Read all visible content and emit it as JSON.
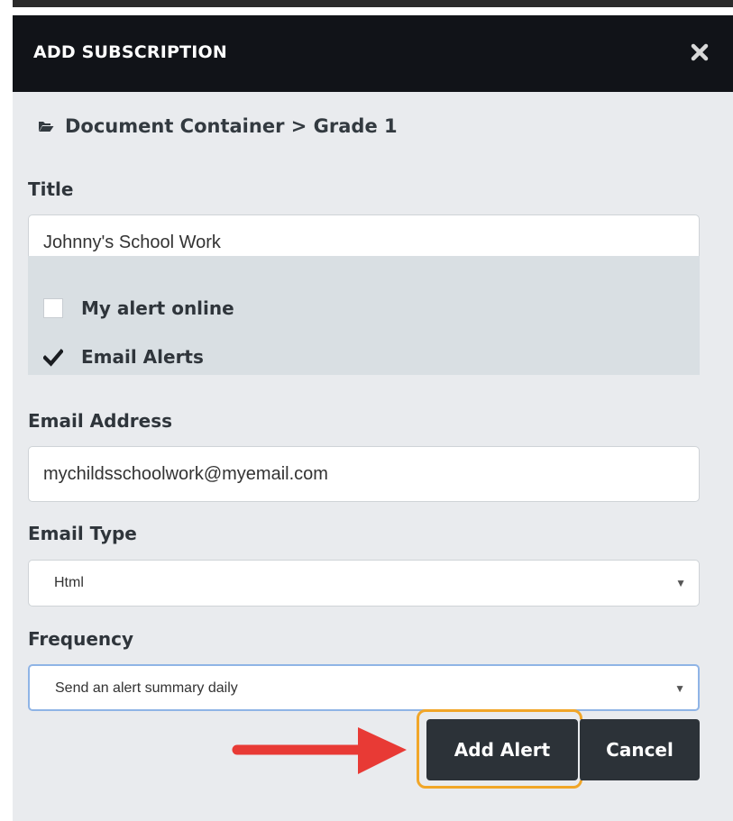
{
  "dialog": {
    "title": "ADD SUBSCRIPTION",
    "close_icon": "close-icon"
  },
  "breadcrumb": {
    "icon": "folder-open-icon",
    "text": "Document Container > Grade 1"
  },
  "form": {
    "title_label": "Title",
    "title_value": "Johnny's School Work",
    "checkboxes": [
      {
        "label": "My alert online",
        "checked": false
      },
      {
        "label": "Email Alerts",
        "checked": true
      }
    ],
    "email_label": "Email Address",
    "email_value": "mychildsschoolwork@myemail.com",
    "email_type_label": "Email Type",
    "email_type_value": "Html",
    "frequency_label": "Frequency",
    "frequency_value": "Send an alert summary daily"
  },
  "buttons": {
    "add_alert": "Add Alert",
    "cancel": "Cancel"
  },
  "annotation": {
    "arrow_color": "#e83a35",
    "highlight_color": "#f1a628"
  },
  "colors": {
    "header_bg": "#111318",
    "modal_bg": "#e9ebee",
    "button_bg": "#2c3238"
  }
}
